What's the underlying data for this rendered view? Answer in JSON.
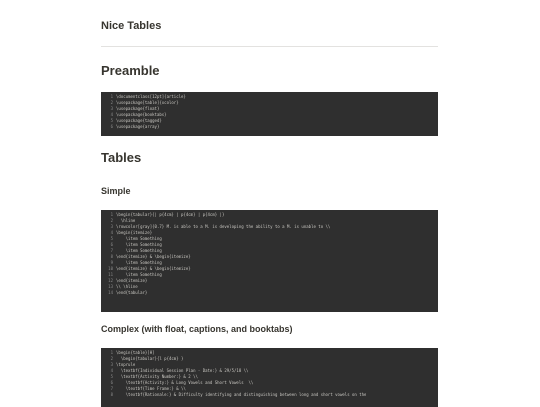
{
  "page": {
    "title": "Nice Tables"
  },
  "sections": {
    "preamble_heading": "Preamble",
    "tables_heading": "Tables",
    "simple_heading": "Simple",
    "complex_heading": "Complex (with float, captions, and booktabs)"
  },
  "code_blocks": {
    "preamble": [
      "\\documentclass[12pt]{article}",
      "\\usepackage[table]{xcolor}",
      "\\usepackage{float}",
      "\\usepackage{booktabs}",
      "\\usepackage{tagged}",
      "\\usepackage{array}"
    ],
    "simple": [
      "\\begin{tabular}{| p{4cm} | p{4cm} | p{4cm} |}",
      "  \\hline",
      "\\rowcolor[gray]{0.7} M. is able to a M. is developing the ability to a M. is unable to \\\\",
      "\\begin{itemize}",
      "    \\item Something",
      "    \\item Something",
      "    \\item Something",
      "\\end{itemize} & \\begin{itemize}",
      "    \\item Something",
      "\\end{itemize} & \\begin{itemize}",
      "    \\item Something",
      "\\end{itemize}",
      "\\\\ \\hline",
      "\\end{tabular}"
    ],
    "complex": [
      "\\begin{table}[H]",
      "  \\begin{tabular}{l p{4cm} }",
      "\\toprule",
      "  \\textbf{Individual Session Plan - Date:} & 29/5/18 \\\\",
      "  \\textbf{Activity Number:} & 2 \\\\",
      "    \\textbf{Activity:} & Long Vowels and Short Vowels  \\\\",
      "    \\textbf{Time Frame:} & \\\\",
      "    \\textbf{Rationale:} & Difficulty identifying and distinguishing between long and short vowels on the"
    ]
  },
  "colors": {
    "code_background": "#2f2f2f",
    "code_text": "#c9c7c2",
    "keyword": "#d08a55",
    "line_number": "#8a8a8a",
    "heading": "#37352f"
  }
}
